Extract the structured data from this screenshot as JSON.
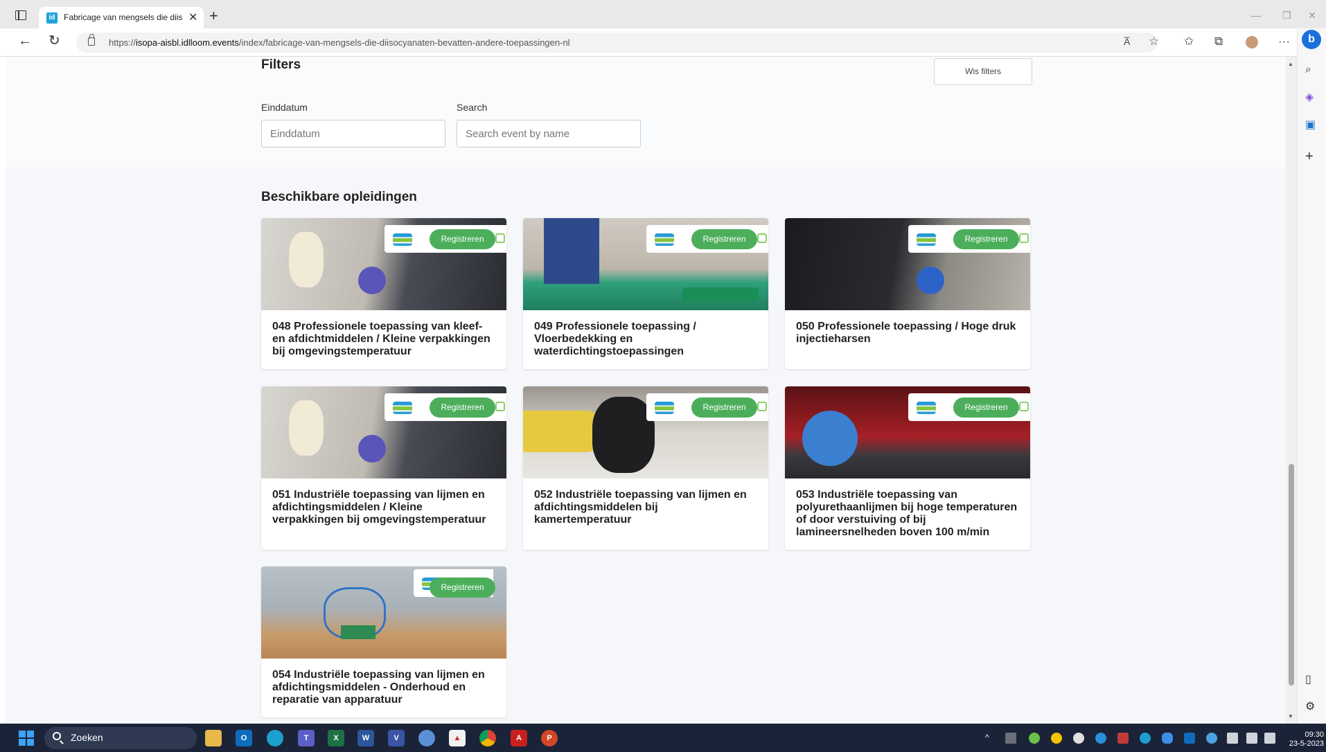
{
  "browser": {
    "tab_title": "Fabricage van mengsels die diisocyanaten bevatten andere toepassingen",
    "tab_favicon": "id",
    "url_prefix": "https://",
    "url_host": "isopa-aisbl.idlloom.events",
    "url_path": "/index/fabricage-van-mengsels-die-diisocyanaten-bevatten-andere-toepassingen-nl",
    "read_aloud_label": "A̅"
  },
  "filters": {
    "title": "Filters",
    "clear_label": "Wis filters",
    "end_date_label": "Einddatum",
    "end_date_placeholder": "Einddatum",
    "search_label": "Search",
    "search_placeholder": "Search event by name"
  },
  "section_title": "Beschikbare opleidingen",
  "cards": [
    {
      "title": "048 Professionele toepassing van kleef- en afdichtmiddelen / Kleine verpakkingen bij omgevingstemperatuur",
      "button": "Registreren",
      "image": "applying-sealant-wall"
    },
    {
      "title": "049 Professionele toepassing / Vloerbedekking en waterdichtingstoepassingen",
      "button": "Registreren",
      "image": "floor-coating"
    },
    {
      "title": "050 Professionele toepassing / Hoge druk injectieharsen",
      "button": "Registreren",
      "image": "injection-gun"
    },
    {
      "title": "051 Industriële toepassing van lijmen en afdichtingsmiddelen / Kleine verpakkingen bij omgevingstemperatuur",
      "button": "Registreren",
      "image": "applying-sealant-wall"
    },
    {
      "title": "052 Industriële toepassing van lijmen en afdichtingsmiddelen bij kamertemperatuur",
      "button": "Registreren",
      "image": "cartridge"
    },
    {
      "title": "053 Industriële toepassing van polyurethaanlijmen bij hoge temperaturen of door verstuiving of bij lamineersnelheden boven 100 m/min",
      "button": "Registreren",
      "image": "laminating-machine"
    },
    {
      "title": "054 Industriële toepassing van lijmen en afdichtingsmiddelen - Onderhoud en reparatie van apparatuur",
      "button": "Registreren",
      "image": "dispensing-robot"
    }
  ],
  "taskbar": {
    "search_text": "Zoeken",
    "time": "09:30",
    "date": "23-5-2023"
  },
  "colors": {
    "register_button": "#4cae5b",
    "taskbar": "#1b2338",
    "page_bg": "#f6f7fa"
  }
}
